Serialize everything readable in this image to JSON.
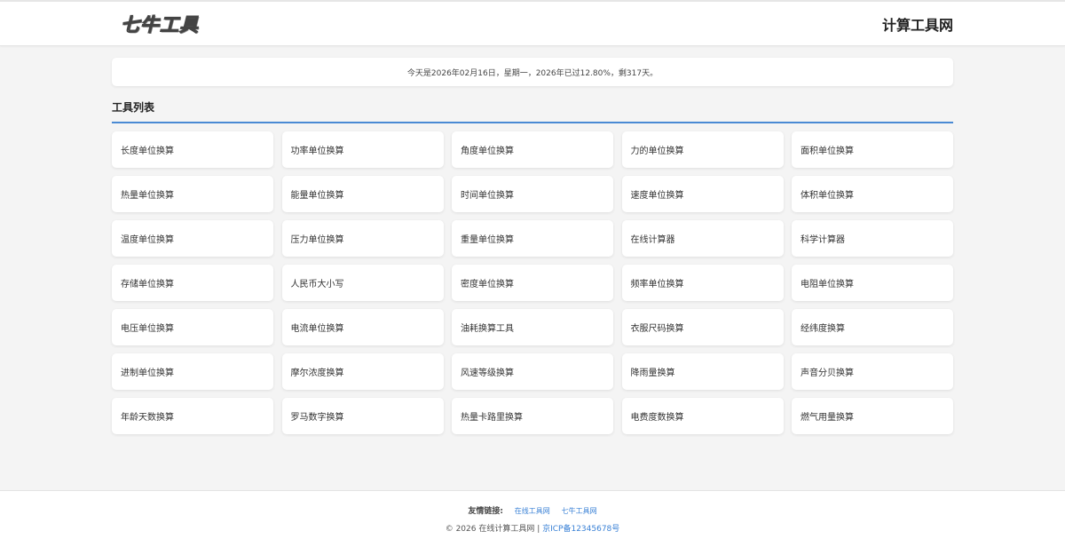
{
  "header": {
    "logo": "七牛工具",
    "site_title": "计算工具网"
  },
  "date_info": "今天是2026年02月16日，星期一，2026年已过12.80%，剩317天。",
  "tools_section": {
    "title": "工具列表",
    "items": [
      "长度单位换算",
      "功率单位换算",
      "角度单位换算",
      "力的单位换算",
      "面积单位换算",
      "热量单位换算",
      "能量单位换算",
      "时间单位换算",
      "速度单位换算",
      "体积单位换算",
      "温度单位换算",
      "压力单位换算",
      "重量单位换算",
      "在线计算器",
      "科学计算器",
      "存储单位换算",
      "人民币大小写",
      "密度单位换算",
      "频率单位换算",
      "电阻单位换算",
      "电压单位换算",
      "电流单位换算",
      "油耗换算工具",
      "衣服尺码换算",
      "经纬度换算",
      "进制单位换算",
      "摩尔浓度换算",
      "风速等级换算",
      "降雨量换算",
      "声音分贝换算",
      "年龄天数换算",
      "罗马数字换算",
      "热量卡路里换算",
      "电费度数换算",
      "燃气用量换算"
    ]
  },
  "footer": {
    "links_label": "友情链接:",
    "links": [
      "在线工具网",
      "七牛工具网"
    ],
    "copyright": "© 2026 在线计算工具网 |",
    "icp": "京ICP备12345678号"
  },
  "colors": {
    "accent": "#4a8ad4",
    "link": "#3b82d6",
    "background": "#f4f4f4"
  }
}
